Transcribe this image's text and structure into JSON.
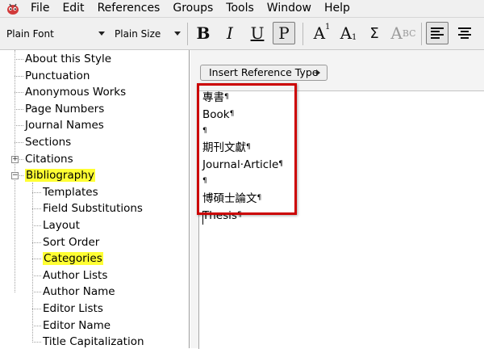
{
  "menu": [
    "File",
    "Edit",
    "References",
    "Groups",
    "Tools",
    "Window",
    "Help"
  ],
  "toolbar": {
    "font": "Plain Font",
    "size": "Plain Size",
    "bold": "B",
    "italic": "I",
    "underline": "U",
    "plain": "P",
    "superscript_base": "A",
    "superscript_mark": "1",
    "subscript_base": "A",
    "subscript_mark": "1",
    "symbol": "Σ",
    "smallcaps_big": "A",
    "smallcaps_small": "BC",
    "pressed_button": "plain"
  },
  "tree": {
    "items": [
      {
        "label": "About this Style"
      },
      {
        "label": "Punctuation"
      },
      {
        "label": "Anonymous Works"
      },
      {
        "label": "Page Numbers"
      },
      {
        "label": "Journal Names"
      },
      {
        "label": "Sections"
      },
      {
        "label": "Citations",
        "expander": "+"
      },
      {
        "label": "Bibliography",
        "expander": "−",
        "highlighted": true
      },
      {
        "label": "Templates"
      },
      {
        "label": "Field Substitutions"
      },
      {
        "label": "Layout"
      },
      {
        "label": "Sort Order"
      },
      {
        "label": "Categories",
        "highlighted": true
      },
      {
        "label": "Author Lists"
      },
      {
        "label": "Author Name"
      },
      {
        "label": "Editor Lists"
      },
      {
        "label": "Editor Name"
      },
      {
        "label": "Title Capitalization"
      }
    ],
    "highlight_color": "#ffff33"
  },
  "editor": {
    "insert_button": "Insert Reference Type",
    "lines": [
      "專書",
      "Book",
      "",
      "期刊文獻",
      "Journal·Article",
      "",
      "博碩士論文",
      "Thesis"
    ],
    "pilcrow": "¶"
  },
  "colors": {
    "annotation_box": "#cc0000",
    "highlight": "#ffff33"
  }
}
